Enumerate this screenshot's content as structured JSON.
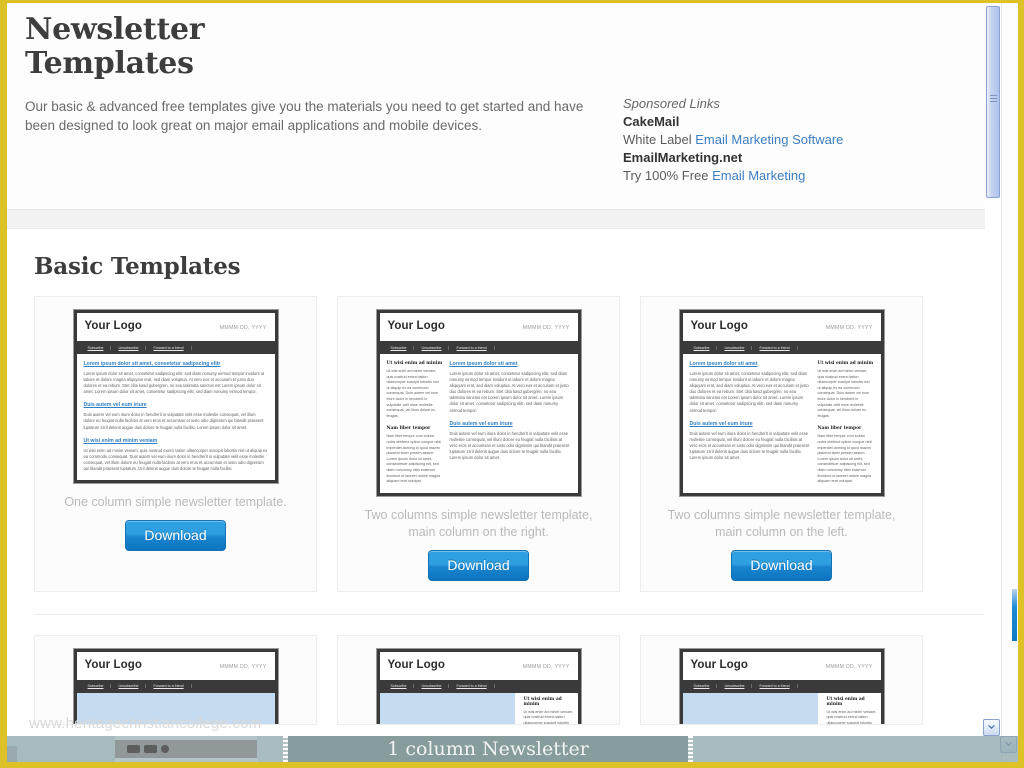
{
  "theme": {
    "frame_color": "#dcc127",
    "accent_blue": "#2e9fe0",
    "link_blue": "#3b7ec1",
    "heading_color": "#3d3d3d"
  },
  "hero": {
    "title_line1": "Newsletter",
    "title_line2": "Templates",
    "description": "Our basic & advanced free templates give you the materials you need to get started and have been designed to look great on major email applications and mobile devices."
  },
  "sponsored": {
    "label": "Sponsored Links",
    "ads": [
      {
        "advertiser": "CakeMail",
        "prefix": "White Label ",
        "link": "Email Marketing Software"
      },
      {
        "advertiser": "EmailMarketing.net",
        "prefix": "Try 100% Free ",
        "link": "Email Marketing"
      }
    ]
  },
  "main": {
    "section_title": "Basic Templates"
  },
  "template_mock": {
    "logo": "Your Logo",
    "date": "MMMM DD, YYYY",
    "nav": [
      "Subscribe",
      "Unsubscribe",
      "Forward to a friend"
    ],
    "headings": {
      "h1_long": "Lorem ipsum dolor sit amet, consetetur sadipscing elitr",
      "h1_short": "Lorem ipsum dolor sit amet",
      "h2": "Duis autem vel eum iriure",
      "h3": "Ut wisi enim ad minim veniam",
      "side1": "Ut wisi enim ad minim",
      "side2": "Nam liber tempor"
    },
    "paragraphs": {
      "p1": "Lorem ipsum dolor sit amet, consetetur sadipscing elitr, sed diam nonumy eirmod tempor invidunt ut labore et dolore magna aliquyam erat, sed diam voluptua. At vero eos et accusam et justo duo dolores et ea rebum. Stet clita kasd gubergren, no sea takimata sanctus est Lorem ipsum dolor sit amet. Lorem ipsum dolor sit amet, consetetur sadipscing elitr, sed diam nonumy eirmod tempor.",
      "p2": "Duis autem vel eum iriure dolor in hendrerit in vulputate velit esse molestie consequat, vel illum dolore eu feugiat nulla facilisis at vero eros et accumsan et iusto odio dignissim qui blandit praesent luptatum zzril delenit augue duis dolore te feugait nulla facilisi. Lorem ipsum dolor sit amet.",
      "p3": "Ut wisi enim ad minim veniam, quis nostrud exerci tation ullamcorper suscipit lobortis nisl ut aliquip ex ea commodo consequat. Duis autem vel eum iriure dolor in hendrerit in vulputate velit esse molestie consequat, vel illum dolore eu feugiat nulla facilisis at vero eros et accumsan et iusto odio dignissim qui blandit praesent luptatum zzril delenit augue duis dolore te feugait nulla facilisi.",
      "side1": "Ut wisi enim ad minim veniam, quis nostrud exerci tation ullamcorper suscipit lobortis nisl ut aliquip ex ea commodo consequat. Duis autem vel eum iriure dolor in hendrerit in vulputate velit esse molestie consequat, vel illum dolore eu feugiat.",
      "side2": "Nam liber tempor cum soluta nobis eleifend option congue nihil imperdiet doming id quod mazim placerat facer possim assum. Lorem ipsum dolor sit amet, consectetuer adipiscing elit, sed diam nonummy nibh euismod tincidunt ut laoreet dolore magna aliquam erat volutpat."
    }
  },
  "cards": [
    {
      "layout": "one-column",
      "caption": "One column simple newsletter template.",
      "download_label": "Download"
    },
    {
      "layout": "side-left",
      "caption": "Two columns simple newsletter template, main column on the right.",
      "download_label": "Download"
    },
    {
      "layout": "side-right",
      "caption": "Two columns simple newsletter template, main column on the left.",
      "download_label": "Download"
    }
  ],
  "watermark": {
    "text": "www.heritagechristiancollege.com"
  },
  "overlay": {
    "title": "1 column Newsletter"
  }
}
